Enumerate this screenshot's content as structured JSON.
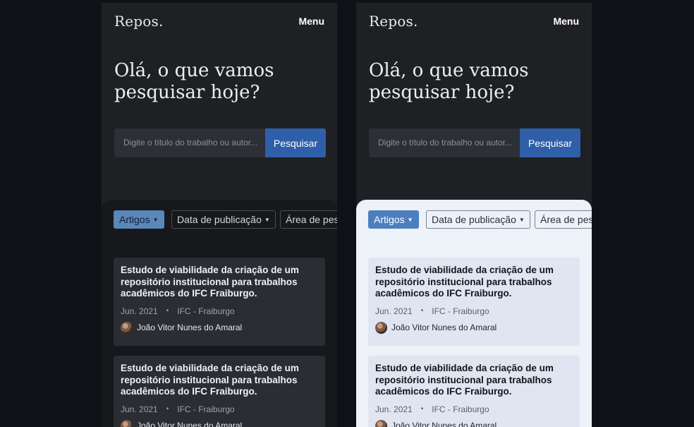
{
  "app": {
    "logo": "Repos.",
    "menu_label": "Menu"
  },
  "hero": {
    "line1": "Olá, o que vamos",
    "line2": "pesquisar hoje?"
  },
  "search": {
    "placeholder": "Digite o título do trabalho ou autor...",
    "button_label": "Pesquisar"
  },
  "filters": [
    {
      "label": "Artigos",
      "active": true
    },
    {
      "label": "Data de publicação",
      "active": false
    },
    {
      "label": "Área de pesquisa",
      "active": false
    }
  ],
  "cards": [
    {
      "title": "Estudo de viabilidade da criação de um repositório institucional para trabalhos acadêmicos do IFC Fraiburgo.",
      "date": "Jun. 2021",
      "separator": "•",
      "campus": "IFC - Fraiburgo",
      "author": "João Vitor Nunes do Amaral"
    },
    {
      "title": "Estudo de viabilidade da criação de um repositório institucional para trabalhos acadêmicos do IFC Fraiburgo.",
      "date": "Jun. 2021",
      "separator": "•",
      "campus": "IFC - Fraiburgo",
      "author": "João Vitor Nunes do Amaral"
    }
  ],
  "themes": {
    "left": "dark",
    "right": "light"
  },
  "colors": {
    "page_background": "#0f1117",
    "screen_background": "#1e2024",
    "primary_button": "#2e5fa8",
    "dark_content": "#17181b",
    "light_content": "#edf1f8",
    "active_chip_dark": "#5a88b8",
    "active_chip_light": "#4d7fbf"
  }
}
